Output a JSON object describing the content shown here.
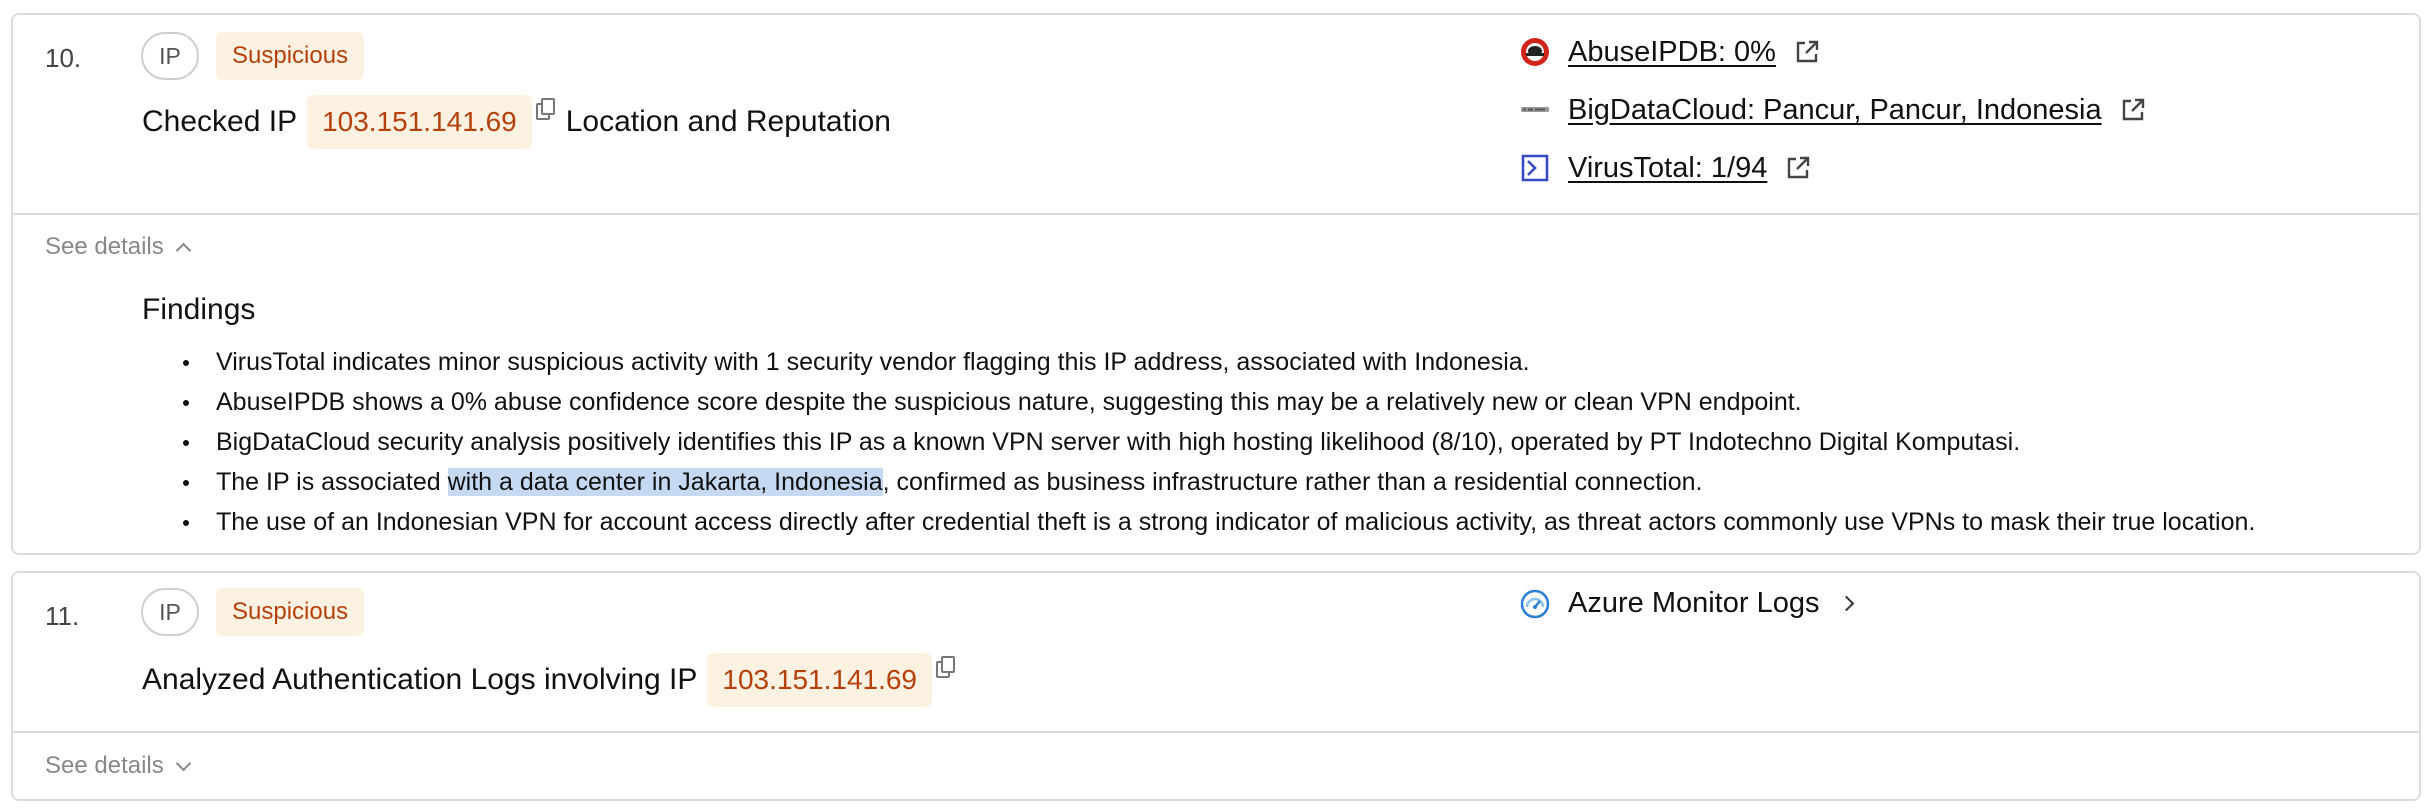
{
  "items": [
    {
      "number": "10.",
      "type_tag": "IP",
      "verdict": "Suspicious",
      "headline_prefix": "Checked IP",
      "ip": "103.151.141.69",
      "headline_suffix": "Location and Reputation",
      "sources": [
        {
          "label": "AbuseIPDB: 0%",
          "icon": "abuseipdb-icon"
        },
        {
          "label": "BigDataCloud: Pancur, Pancur, Indonesia",
          "icon": "bigdatacloud-icon"
        },
        {
          "label": "VirusTotal: 1/94",
          "icon": "virustotal-icon"
        }
      ],
      "see_details": "See details",
      "details_expanded": true,
      "findings_title": "Findings",
      "findings": [
        {
          "text": "VirusTotal indicates minor suspicious activity with 1 security vendor flagging this IP address, associated with Indonesia."
        },
        {
          "text": "AbuseIPDB shows a 0% abuse confidence score despite the suspicious nature, suggesting this may be a relatively new or clean VPN endpoint."
        },
        {
          "text": "BigDataCloud security analysis positively identifies this IP as a known VPN server with high hosting likelihood (8/10), operated by PT Indotechno Digital Komputasi."
        },
        {
          "pre": "The IP is associated ",
          "highlight": "with a data center in Jakarta, Indonesia",
          "post": ", confirmed as business infrastructure rather than a residential connection."
        },
        {
          "text": "The use of an Indonesian VPN for account access directly after credential theft is a strong indicator of malicious activity, as threat actors commonly use VPNs to mask their true location."
        }
      ]
    },
    {
      "number": "11.",
      "type_tag": "IP",
      "verdict": "Suspicious",
      "headline_prefix": "Analyzed Authentication Logs involving IP",
      "ip": "103.151.141.69",
      "source": {
        "label": "Azure Monitor Logs",
        "icon": "azure-monitor-icon"
      },
      "see_details": "See details",
      "details_expanded": false
    }
  ],
  "colors": {
    "suspicious_text": "#b5400a",
    "suspicious_bg": "#fdf1e2",
    "highlight": "#c6d9f2",
    "border": "#dcdcdc",
    "virustotal": "#3949c8",
    "abuseipdb": "#d1251b",
    "azure": "#2a7fd6"
  }
}
